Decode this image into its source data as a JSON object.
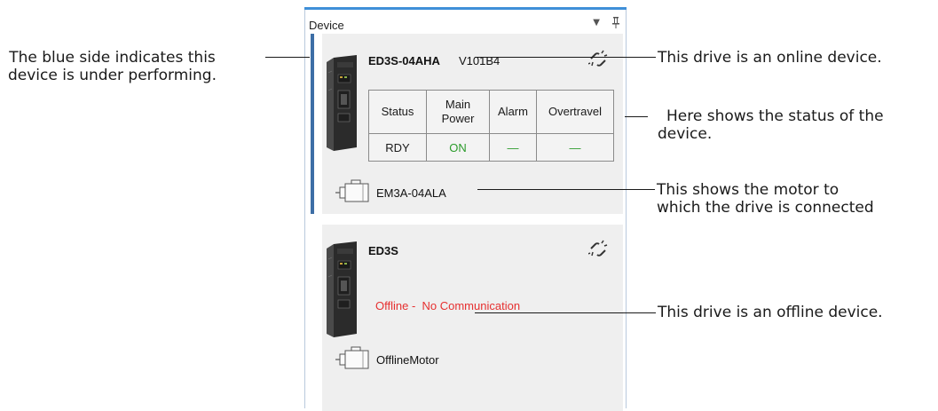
{
  "panel": {
    "title": "Device",
    "dropdown_glyph": "▼",
    "pin_icon": "pin-icon"
  },
  "devices": [
    {
      "state": "online",
      "active": true,
      "model": "ED3S-04AHA",
      "version": "V101B4",
      "link_icon": "link-broken-icon",
      "status_table": {
        "headers": [
          "Status",
          "Main\nPower",
          "Alarm",
          "Overtravel"
        ],
        "values": [
          "RDY",
          "ON",
          "—",
          "—"
        ]
      },
      "motor": "EM3A-04ALA"
    },
    {
      "state": "offline",
      "active": false,
      "model": "ED3S",
      "link_icon": "link-broken-icon",
      "status_text": "Offline -  No Communication",
      "motor": "OfflineMotor"
    }
  ],
  "callouts": {
    "blue_side": "The blue side indicates this\ndevice is under performing.",
    "online": "This drive is an online device.",
    "status": "Here shows the status of the\ndevice.",
    "motor": "This shows the motor to\nwhich the drive is connected",
    "offline": "This drive is an offline device."
  },
  "colors": {
    "accent_bar": "#3d6ea6",
    "panel_top": "#3f8fd8",
    "status_on": "#2b9b2b",
    "offline_text": "#e63030",
    "card_bg": "#efefef"
  }
}
